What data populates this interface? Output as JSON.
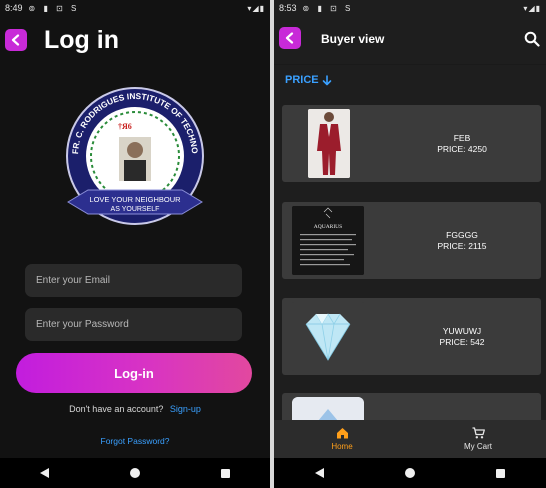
{
  "left_screen": {
    "status_time": "8:49",
    "title": "Log in",
    "logo": {
      "ring_text": "FR. C. RODRIGUES INSTITUTE OF TECHNOLOGY : VASHI",
      "banner_line1": "LOVE YOUR NEIGHBOUR",
      "banner_line2": "AS YOURSELF"
    },
    "email_placeholder": "Enter your Email",
    "password_placeholder": "Enter your Password",
    "login_button": "Log-in",
    "no_account_text": "Don't have an account?",
    "signup_link": "Sign-up",
    "forgot_link": "Forgot Password?"
  },
  "right_screen": {
    "status_time": "8:53",
    "title": "Buyer view",
    "sort_label": "PRICE",
    "products": [
      {
        "name": "FEB",
        "price": "PRICE: 4250",
        "image": "red-suit"
      },
      {
        "name": "FGGGG",
        "price": "PRICE: 2115",
        "image": "aquarius-poster"
      },
      {
        "name": "YUWUWJ",
        "price": "PRICE: 542",
        "image": "diamond"
      },
      {
        "name": "",
        "price": "",
        "image": "partial-item"
      }
    ],
    "tabs": [
      {
        "label": "Home",
        "icon": "home-icon",
        "active": true
      },
      {
        "label": "My Cart",
        "icon": "cart-icon",
        "active": false
      }
    ]
  },
  "colors": {
    "accent_purple": "#c82ad8",
    "link_blue": "#3aa0ff",
    "active_tab_orange": "#ff9f1a"
  }
}
